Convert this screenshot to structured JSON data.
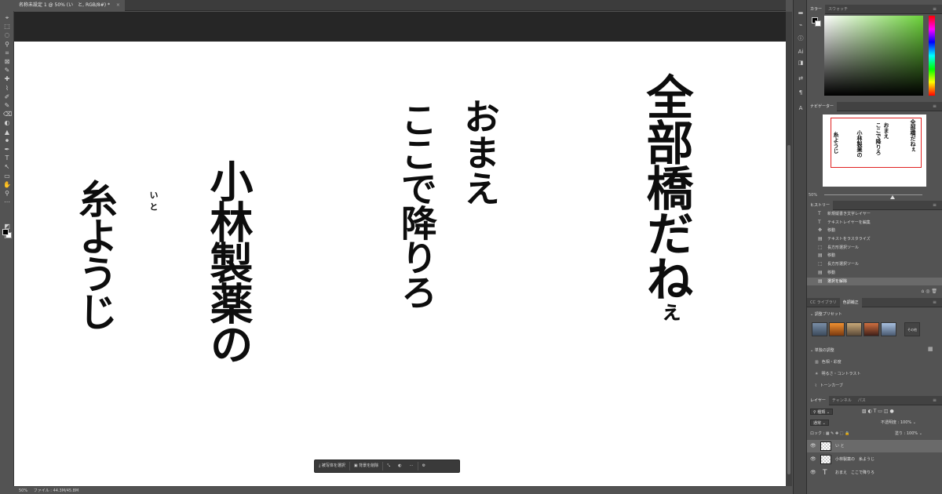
{
  "document": {
    "tab_title": "名称未設定 1 @ 50% (い　と, RGB/8#) *",
    "close": "×"
  },
  "toolbar": {
    "tools": [
      "⌖",
      "⬚",
      "◌",
      "⚲",
      "⌗",
      "⊠",
      "✎",
      "✚",
      "⌇",
      "✐",
      "✎",
      "⌫",
      "◐",
      "▲",
      "⚫",
      "✒",
      "T",
      "↖",
      "▭",
      "✋",
      "⚲",
      "⋯",
      "◩",
      "◫"
    ]
  },
  "canvas": {
    "text1": "全部橋だね",
    "text1_small": "ぇ",
    "text2a": "おまえ",
    "text2b": "ここで降りろ",
    "text3": "小林製薬の",
    "text4": "糸ようじ",
    "furigana": "い と"
  },
  "taskbar": {
    "select_subject": "被写体を選択",
    "remove_bg": "背景を削除",
    "more": "⋯"
  },
  "status": {
    "zoom": "50%",
    "file_info": "ファイル : 44.3M/45.8M"
  },
  "panels": {
    "color_tabs": [
      "カラー",
      "スウォッチ"
    ],
    "navigator_tab": "ナビゲーター",
    "nav_zoom": "50%",
    "history_tab": "ヒストリー",
    "history_items": [
      {
        "icon": "T",
        "label": "新規縦書き文字レイヤー"
      },
      {
        "icon": "T",
        "label": "テキストレイヤーを編集"
      },
      {
        "icon": "✥",
        "label": "移動"
      },
      {
        "icon": "▤",
        "label": "テキストをラスタライズ"
      },
      {
        "icon": "⬚",
        "label": "長方形選択ツール"
      },
      {
        "icon": "▤",
        "label": "移動"
      },
      {
        "icon": "⬚",
        "label": "長方形選択ツール"
      },
      {
        "icon": "▤",
        "label": "移動"
      },
      {
        "icon": "▤",
        "label": "選択を解除"
      }
    ],
    "library_tabs": [
      "CC ライブラリ",
      "色調補正"
    ],
    "adjust_presets": "調整プリセット",
    "preset_more": "その他",
    "single_adjust": "単独の調整",
    "adjust_items": [
      {
        "icon": "▥",
        "label": "色相・彩度"
      },
      {
        "icon": "☀",
        "label": "明るさ・コントラスト"
      },
      {
        "icon": "⌇",
        "label": "トーンカーブ"
      }
    ],
    "layer_tabs": [
      "レイヤー",
      "チャンネル",
      "パス"
    ],
    "kind_filter": "種類",
    "blend_mode": "通常",
    "opacity_label": "不透明度 :",
    "opacity_value": "100%",
    "lock_label": "ロック :",
    "fill_label": "塗り :",
    "fill_value": "100%",
    "layers": [
      {
        "name": "い と",
        "type": "raster",
        "selected": true
      },
      {
        "name": "小林製薬の　糸ようじ",
        "type": "raster",
        "selected": false
      },
      {
        "name": "おまえ　ここで降りろ",
        "type": "text",
        "selected": false
      }
    ]
  }
}
